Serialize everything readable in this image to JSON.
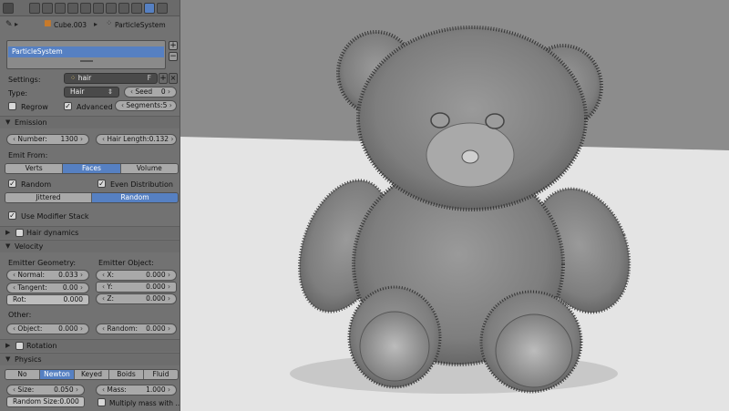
{
  "header": {
    "object_name": "Cube.003",
    "system_name": "ParticleSystem"
  },
  "particle_list": {
    "items": [
      "ParticleSystem"
    ]
  },
  "settings": {
    "settings_label": "Settings:",
    "settings_value": "hair",
    "type_label": "Type:",
    "type_value": "Hair",
    "seed_label": "Seed",
    "seed_value": "0",
    "regrow_label": "Regrow",
    "advanced_label": "Advanced",
    "segments_label": "Segments:",
    "segments_value": "5"
  },
  "emission": {
    "title": "Emission",
    "number_label": "Number:",
    "number_value": "1300",
    "hair_length_label": "Hair Length:",
    "hair_length_value": "0.132",
    "emit_from_label": "Emit From:",
    "emit_from_options": [
      "Verts",
      "Faces",
      "Volume"
    ],
    "emit_from_selected": 1,
    "random_label": "Random",
    "even_distribution_label": "Even Distribution",
    "distribution_options": [
      "Jittered",
      "Random"
    ],
    "distribution_selected": 1,
    "use_modifier_stack_label": "Use Modifier Stack"
  },
  "hair_dynamics": {
    "title": "Hair dynamics"
  },
  "velocity": {
    "title": "Velocity",
    "emitter_geometry_label": "Emitter Geometry:",
    "emitter_object_label": "Emitter Object:",
    "normal_label": "Normal:",
    "normal_value": "0.033",
    "tangent_label": "Tangent:",
    "tangent_value": "0.00",
    "rot_label": "Rot:",
    "rot_value": "0.000",
    "x_label": "X:",
    "x_value": "0.000",
    "y_label": "Y:",
    "y_value": "0.000",
    "z_label": "Z:",
    "z_value": "0.000",
    "other_label": "Other:",
    "object_label": "Object:",
    "object_value": "0.000",
    "random_label": "Random:",
    "random_value": "0.000"
  },
  "rotation": {
    "title": "Rotation"
  },
  "physics": {
    "title": "Physics",
    "options": [
      "No",
      "Newton",
      "Keyed",
      "Boids",
      "Fluid"
    ],
    "selected": 1,
    "size_label": "Size:",
    "size_value": "0.050",
    "mass_label": "Mass:",
    "mass_value": "1.000",
    "random_size_label": "Random Size:",
    "random_size_value": "0.000",
    "multiply_mass_label": "Multiply mass with ..."
  },
  "colors": {
    "selection_blue": "#5680c2",
    "panel_bg": "#727272",
    "field_bg": "#a9a9a9",
    "viewport_bg": "#8c8c8c",
    "floor": "#e4e4e4"
  }
}
